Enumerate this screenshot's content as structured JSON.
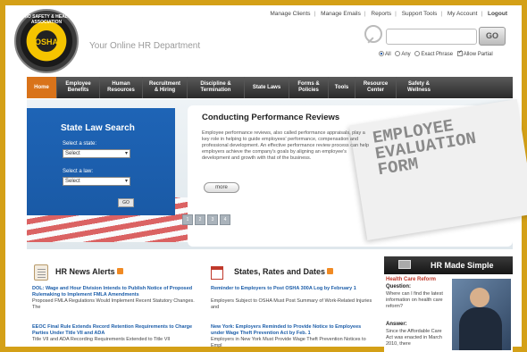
{
  "header": {
    "tagline": "Your Online HR Department",
    "logo_text": "OSHA",
    "logo_ring_text": "OHIO SAFETY & HEALTH ASSOCIATION"
  },
  "toplinks": [
    "Manage Clients",
    "Manage Emails",
    "Reports",
    "Support Tools",
    "My Account",
    "Logout"
  ],
  "search": {
    "value": "",
    "go_label": "GO",
    "options": [
      {
        "label": "All",
        "type": "radio",
        "checked": true
      },
      {
        "label": "Any",
        "type": "radio",
        "checked": false
      },
      {
        "label": "Exact Phrase",
        "type": "radio",
        "checked": false
      },
      {
        "label": "Allow Partial",
        "type": "checkbox",
        "checked": true
      }
    ]
  },
  "nav": {
    "items": [
      "Home",
      "Employee Benefits",
      "Human Resources",
      "Recruitment & Hiring",
      "Discipline & Termination",
      "State Laws",
      "Forms & Policies",
      "Tools",
      "Resource Center",
      "Safety & Wellness"
    ]
  },
  "state_law": {
    "title": "State Law Search",
    "state_label": "Select a state:",
    "state_value": "Select",
    "law_label": "Select a law:",
    "law_value": "Select",
    "go_label": "GO"
  },
  "feature": {
    "title": "Conducting Performance Reviews",
    "body": "Employee performance reviews, also called performance appraisals, play a key role in helping to guide employees' performance, compensation and professional development. An effective performance review process can help employers achieve the company's goals by aligning an employee's development and growth with that of the business.",
    "more_label": "more",
    "image_text_lines": [
      "EMPLOYEE",
      "EVALUATION",
      "FORM"
    ],
    "pager": [
      "1",
      "2",
      "3",
      "4"
    ]
  },
  "news": {
    "title": "HR News Alerts",
    "entries": [
      {
        "link": "DOL: Wage and Hour Division Intends to Publish Notice of Proposed Rulemaking to Implement FMLA Amendments",
        "text": "Proposed FMLA Regulations Would Implement Recent Statutory Changes. The"
      },
      {
        "link": "EEOC Final Rule Extends Record Retention Requirements to Charge Parties Under Title VII and ADA",
        "text": "Title VII and ADA Recording Requirements Extended to Title VII"
      }
    ]
  },
  "rates": {
    "title": "States, Rates and Dates",
    "entries": [
      {
        "link": "Reminder to Employers to Post OSHA 300A Log by February 1",
        "text": "Employers Subject to OSHA Must Post Summary of Work-Related Injuries and"
      },
      {
        "link": "New York: Employers Reminded to Provide Notice to Employees under Wage Theft Prevention Act by Feb. 1",
        "text": "Employers in New York Must Provide Wage Theft Prevention Notices to Empl"
      }
    ]
  },
  "hr_made_simple": {
    "title": "HR Made Simple",
    "topic": "Health Care Reform",
    "question_label": "Question:",
    "question": "Where can I find the latest information on health care reform?",
    "answer_label": "Answer:",
    "answer": "Since the Affordable Care Act was enacted in March 2010, there"
  },
  "colors": {
    "frame_border": "#d4a017",
    "nav_home": "#d9731a",
    "link": "#1a5ca8",
    "accent_red": "#c0392b"
  }
}
